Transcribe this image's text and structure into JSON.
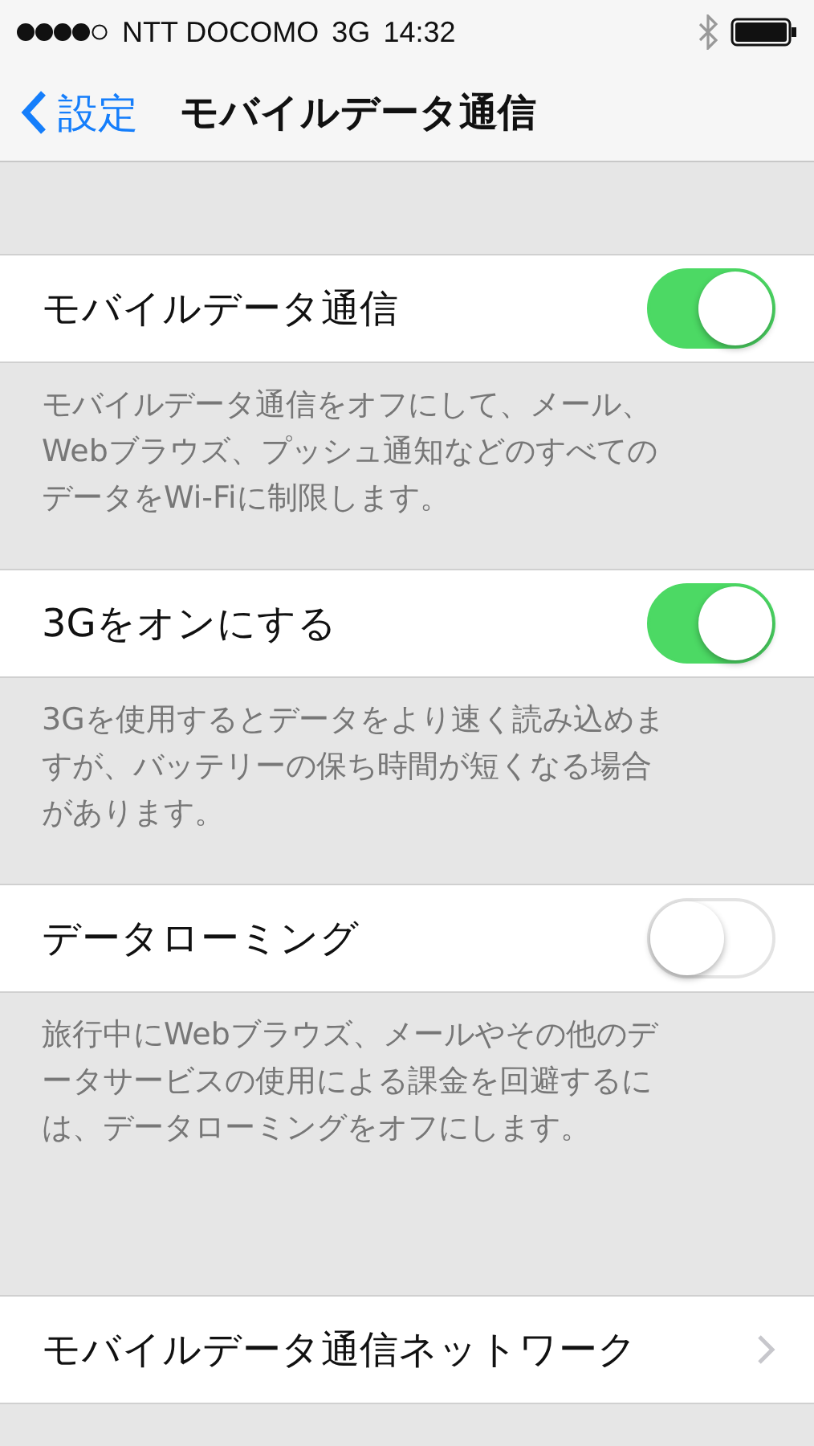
{
  "status_bar": {
    "carrier": "NTT DOCOMO",
    "network": "3G",
    "time": "14:32"
  },
  "nav": {
    "back": "設定",
    "title": "モバイルデータ通信"
  },
  "sections": [
    {
      "rows": [
        {
          "kind": "toggle",
          "label": "モバイルデータ通信",
          "on": true
        }
      ],
      "footer_lines": [
        "モバイルデータ通信をオフにして、メール、",
        "Webブラウズ、プッシュ通知などのすべての",
        "データをWi-Fiに制限します。"
      ]
    },
    {
      "rows": [
        {
          "kind": "toggle",
          "label": "3Gをオンにする",
          "on": true
        }
      ],
      "footer_lines": [
        "3Gを使用するとデータをより速く読み込めま",
        "すが、バッテリーの保ち時間が短くなる場合",
        "があります。"
      ]
    },
    {
      "rows": [
        {
          "kind": "toggle",
          "label": "データローミング",
          "on": false
        }
      ],
      "footer_lines": [
        "旅行中にWebブラウズ、メールやその他のデ",
        "ータサービスの使用による課金を回避するに",
        "は、データローミングをオフにします。"
      ]
    },
    {
      "rows": [
        {
          "kind": "disclosure",
          "label": "モバイルデータ通信ネットワーク"
        }
      ]
    }
  ]
}
